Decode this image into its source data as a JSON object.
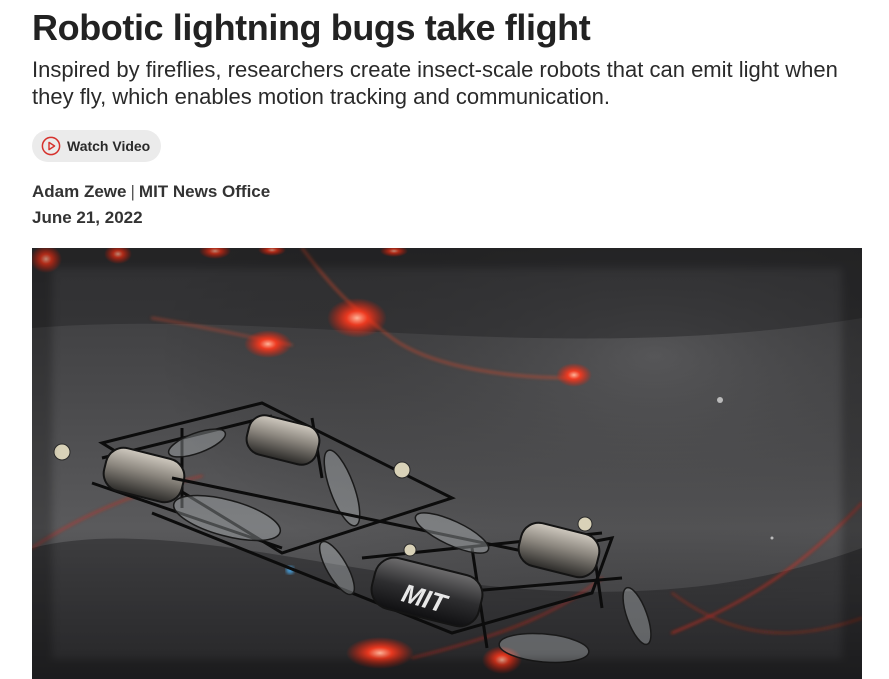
{
  "article": {
    "title": "Robotic lightning bugs take flight",
    "subtitle": "Inspired by fireflies, researchers create insect-scale robots that can emit light when they fly, which enables motion tracking and communication.",
    "watch_video_label": "Watch Video",
    "author": "Adam Zewe",
    "byline_separator": "|",
    "organization": "MIT News Office",
    "date": "June 21, 2022"
  },
  "hero_image": {
    "robot_label": "MIT"
  },
  "colors": {
    "play_icon_accent": "#d6322d",
    "button_background": "#ebebeb",
    "glow_red": "#ff3b1f"
  },
  "icons": {
    "watch_video": "play-circle-icon"
  }
}
